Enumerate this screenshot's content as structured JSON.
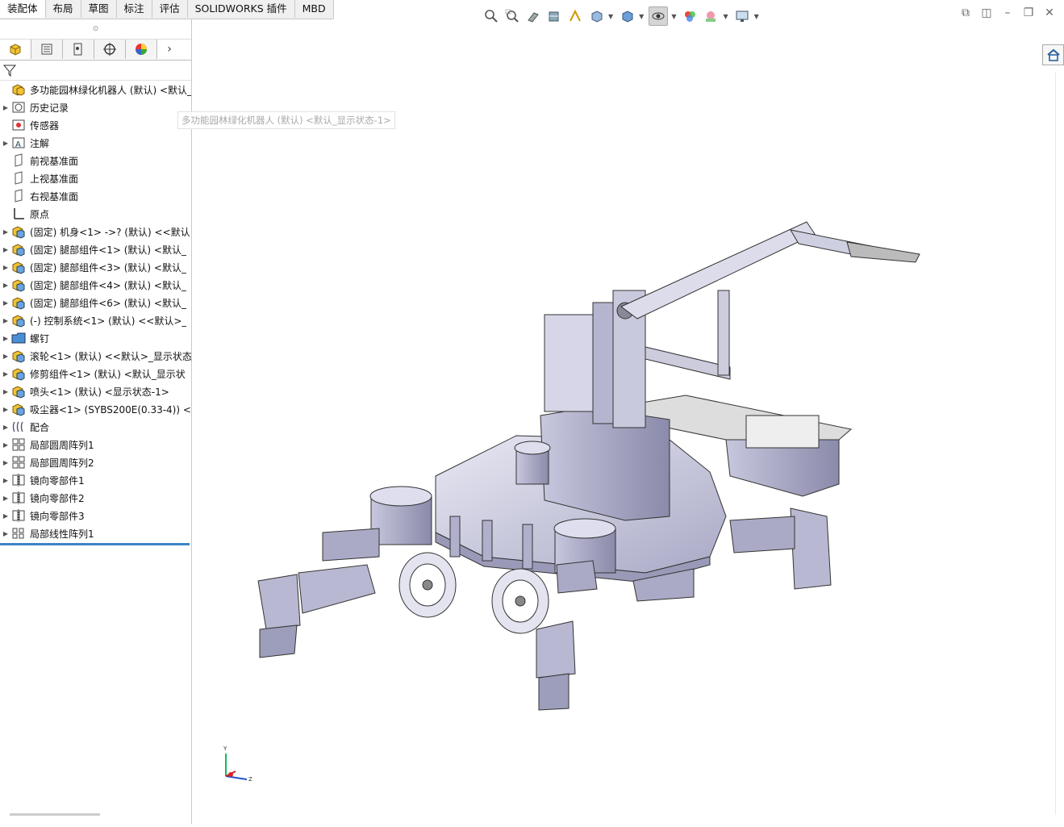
{
  "ribbon_tabs": [
    "装配体",
    "布局",
    "草图",
    "标注",
    "评估",
    "SOLIDWORKS 插件",
    "MBD"
  ],
  "active_tab_index": 0,
  "view_icons": [
    "zoom-to-fit-icon",
    "zoom-area-icon",
    "previous-view-icon",
    "section-view-icon",
    "dynamic-annotation-icon",
    "view-orientation-icon",
    "display-style-icon",
    "hide-show-icon",
    "edit-appearance-icon",
    "apply-scene-icon",
    "view-settings-icon"
  ],
  "window_controls": [
    "restore-icon",
    "tile-icon",
    "minimize-icon",
    "maximize-icon",
    "close-icon"
  ],
  "tree": {
    "root": "多功能园林绿化机器人 (默认) <默认_显示",
    "tooltip": "多功能园林绿化机器人 (默认) <默认_显示状态-1>",
    "items": [
      {
        "label": "历史记录",
        "icon": "history",
        "exp": true
      },
      {
        "label": "传感器",
        "icon": "sensor",
        "exp": false
      },
      {
        "label": "注解",
        "icon": "annotation",
        "exp": true
      },
      {
        "label": "前视基准面",
        "icon": "plane",
        "exp": false
      },
      {
        "label": "上视基准面",
        "icon": "plane",
        "exp": false
      },
      {
        "label": "右视基准面",
        "icon": "plane",
        "exp": false
      },
      {
        "label": "原点",
        "icon": "origin",
        "exp": false
      },
      {
        "label": "(固定) 机身<1> ->? (默认) <<默认",
        "icon": "part",
        "exp": true
      },
      {
        "label": "(固定) 腿部组件<1> (默认) <默认_",
        "icon": "part",
        "exp": true
      },
      {
        "label": "(固定) 腿部组件<3> (默认) <默认_",
        "icon": "part",
        "exp": true
      },
      {
        "label": "(固定) 腿部组件<4> (默认) <默认_",
        "icon": "part",
        "exp": true
      },
      {
        "label": "(固定) 腿部组件<6> (默认) <默认_",
        "icon": "part",
        "exp": true
      },
      {
        "label": "(-) 控制系统<1> (默认) <<默认>_",
        "icon": "part",
        "exp": true
      },
      {
        "label": "螺钉",
        "icon": "folder",
        "exp": true
      },
      {
        "label": "滚轮<1> (默认) <<默认>_显示状态",
        "icon": "part",
        "exp": true
      },
      {
        "label": "修剪组件<1> (默认) <默认_显示状",
        "icon": "part",
        "exp": true
      },
      {
        "label": "喷头<1> (默认) <显示状态-1>",
        "icon": "part",
        "exp": true
      },
      {
        "label": "吸尘器<1> (SYBS200E(0.33-4)) <",
        "icon": "part",
        "exp": true
      },
      {
        "label": "配合",
        "icon": "mates",
        "exp": true
      },
      {
        "label": "局部圆周阵列1",
        "icon": "pattern",
        "exp": true
      },
      {
        "label": "局部圆周阵列2",
        "icon": "pattern",
        "exp": true
      },
      {
        "label": "镜向零部件1",
        "icon": "mirror",
        "exp": true
      },
      {
        "label": "镜向零部件2",
        "icon": "mirror",
        "exp": true
      },
      {
        "label": "镜向零部件3",
        "icon": "mirror",
        "exp": true
      },
      {
        "label": "局部线性阵列1",
        "icon": "linpattern",
        "exp": true
      }
    ]
  },
  "triad": {
    "y": "Y",
    "z": "Z"
  }
}
